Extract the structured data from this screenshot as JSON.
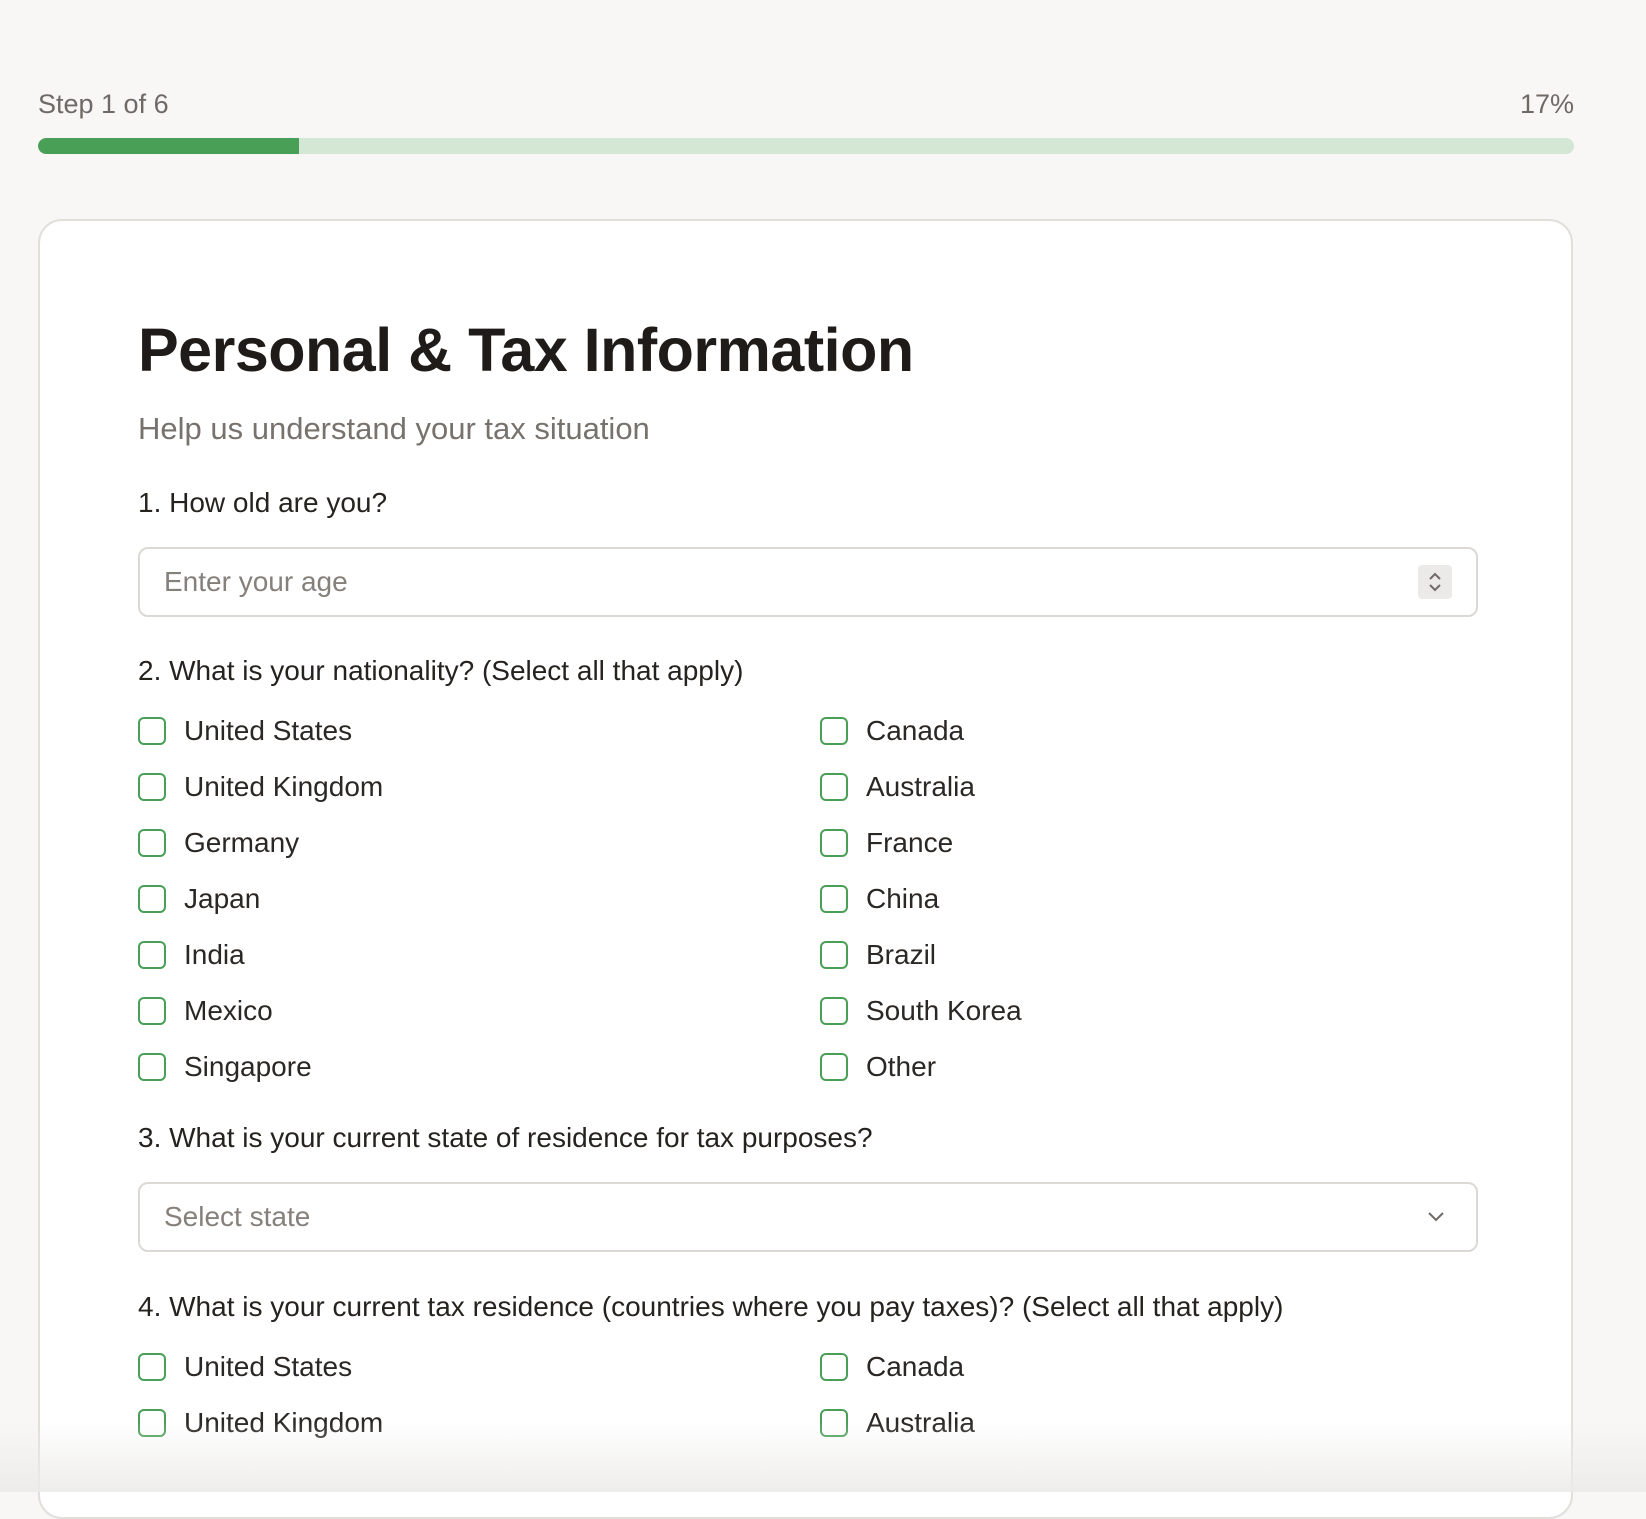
{
  "progress": {
    "step_label": "Step 1 of 6",
    "percent_label": "17%",
    "fraction": 0.17
  },
  "form": {
    "title": "Personal & Tax Information",
    "subtitle": "Help us understand your tax situation",
    "q1": {
      "label": "1. How old are you?",
      "placeholder": "Enter your age"
    },
    "q2": {
      "label": "2. What is your nationality? (Select all that apply)",
      "options": [
        "United States",
        "Canada",
        "United Kingdom",
        "Australia",
        "Germany",
        "France",
        "Japan",
        "China",
        "India",
        "Brazil",
        "Mexico",
        "South Korea",
        "Singapore",
        "Other"
      ]
    },
    "q3": {
      "label": "3. What is your current state of residence for tax purposes?",
      "selected": "Select state"
    },
    "q4": {
      "label": "4. What is your current tax residence (countries where you pay taxes)? (Select all that apply)",
      "options": [
        "United States",
        "Canada",
        "United Kingdom",
        "Australia"
      ]
    }
  },
  "colors": {
    "accent": "#4a9f57",
    "track": "#d4e6d4"
  }
}
